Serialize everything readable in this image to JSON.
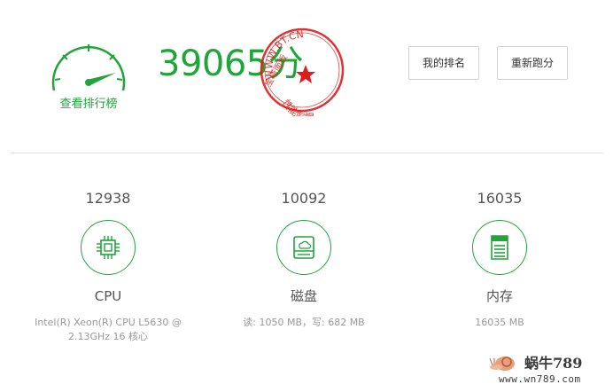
{
  "header": {
    "rank_link": "查看排行榜",
    "total_score": "39065",
    "score_unit": "分",
    "stamp": {
      "url_text": "WWW.BT.CN",
      "left_text": "宝塔面板",
      "bottom_text": "性能彪悍",
      "color": "#e01b1b"
    },
    "buttons": {
      "rank": "我的排名",
      "retest": "重新跑分"
    }
  },
  "metrics": [
    {
      "score": "12938",
      "name": "CPU",
      "desc_line1": "Intel(R) Xeon(R) CPU L5630 @",
      "desc_line2": "2.13GHz 16 核心",
      "icon": "cpu-chip-icon"
    },
    {
      "score": "10092",
      "name": "磁盘",
      "desc_line1": "读: 1050 MB，写: 682 MB",
      "desc_line2": "",
      "icon": "disk-drive-icon"
    },
    {
      "score": "16035",
      "name": "内存",
      "desc_line1": "16035 MB",
      "desc_line2": "",
      "icon": "memory-icon"
    }
  ],
  "watermark": {
    "title": "蜗牛789",
    "url": "www.wn789.com"
  },
  "colors": {
    "accent": "#20a53a",
    "stamp_red": "#e01b1b"
  }
}
